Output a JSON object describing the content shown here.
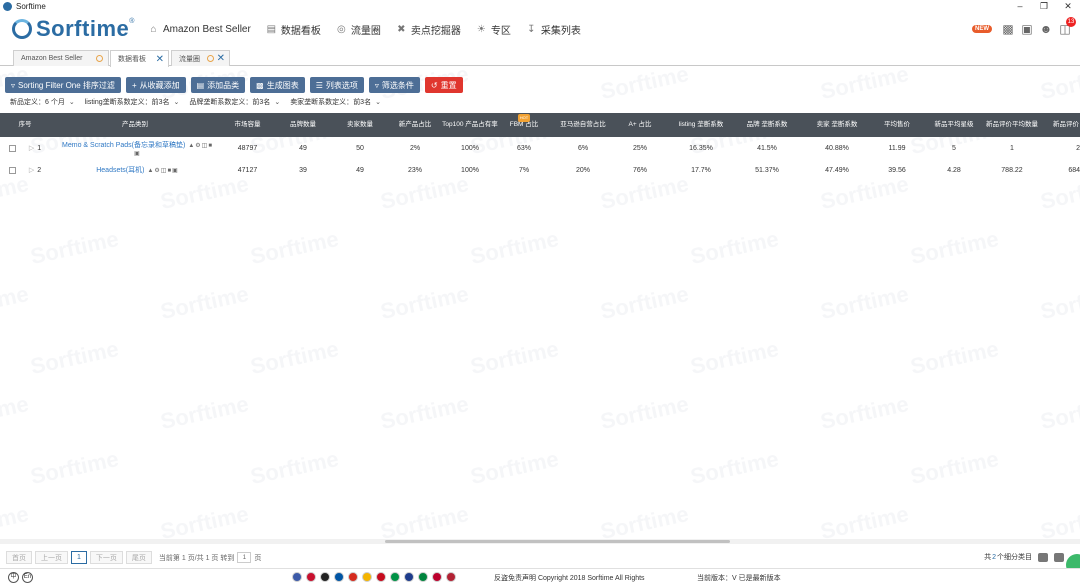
{
  "window": {
    "title": "Sorftime"
  },
  "header": {
    "brand": "Sorftime",
    "brand_mark": "®",
    "nav": [
      {
        "icon": "home-icon",
        "label": "Amazon Best Seller"
      },
      {
        "icon": "chart-board-icon",
        "label": "数据看板"
      },
      {
        "icon": "target-icon",
        "label": "流量圈"
      },
      {
        "icon": "tools-icon",
        "label": "卖点挖掘器"
      },
      {
        "icon": "bulb-icon",
        "label": "专区"
      },
      {
        "icon": "download-icon",
        "label": "采集列表"
      }
    ],
    "new_badge": "NEW",
    "cart_count": "13"
  },
  "tabs": [
    {
      "label": "Amazon Best Seller"
    },
    {
      "label": "数据看板"
    },
    {
      "label": "流量圈"
    }
  ],
  "toolbar": {
    "sort": "Sorting Filter One 排序过滤",
    "add_fav": "从收藏添加",
    "add_cat": "添加品类",
    "gen_chart": "生成图表",
    "columns": "列表选项",
    "filter": "筛选条件",
    "reset": "重置"
  },
  "filters": [
    {
      "label": "新品定义：",
      "value": "6 个月"
    },
    {
      "label": "listing垄断系数定义：",
      "value": "前3名"
    },
    {
      "label": "品牌垄断系数定义：",
      "value": "前3名"
    },
    {
      "label": "卖家垄断系数定义：",
      "value": "前3名"
    }
  ],
  "table": {
    "fbm_hot": "HOT",
    "headers": [
      "序号",
      "产品类别",
      "市场容量",
      "品牌数量",
      "卖家数量",
      "新产品占比",
      "Top100 产品占有率",
      "FBM 占比",
      "亚马逊自营占比",
      "A+ 占比",
      "listing 垄断系数",
      "品牌 垄断系数",
      "卖家 垄断系数",
      "平均售价",
      "新品平均星级",
      "新品评价平均数量",
      "新品评价"
    ],
    "rows": [
      {
        "no": "1",
        "category": "Memo & Scratch Pads(备忘录和草稿垫)",
        "cells": [
          "48797",
          "49",
          "50",
          "2%",
          "100%",
          "63%",
          "6%",
          "25%",
          "16.35%",
          "41.5%",
          "40.88%",
          "11.99",
          "5",
          "1",
          "2"
        ]
      },
      {
        "no": "2",
        "category": "Headsets(耳机)",
        "cells": [
          "47127",
          "39",
          "49",
          "23%",
          "100%",
          "7%",
          "20%",
          "76%",
          "17.7%",
          "51.37%",
          "47.49%",
          "39.56",
          "4.28",
          "788.22",
          "684"
        ]
      }
    ]
  },
  "pager": {
    "first": "首页",
    "prev": "上一页",
    "current": "1",
    "next": "下一页",
    "last": "尾页",
    "info": "当前第 1 页/共 1 页 转到",
    "goto_value": "1",
    "page_unit": "页",
    "total_prefix": "共",
    "total_count": "2",
    "total_suffix": "个细分类目"
  },
  "footer": {
    "lang_cn": "中",
    "lang_en": "En",
    "copyright": "反盗免责声明 Copyright 2018 Sorftime All Rights",
    "version": "当前版本：V  已是最新版本",
    "flag_colors": [
      "#3c5aa8",
      "#c8102e",
      "#222222",
      "#0055a4",
      "#d52b1e",
      "#f4b400",
      "#c60b1e",
      "#009246",
      "#1e3c8c",
      "#00843d",
      "#bc002d",
      "#b22234"
    ]
  },
  "colors": {
    "primary": "#2b6ca3",
    "button": "#4d6e96",
    "reset": "#e0362e",
    "header_bg": "#4a5159",
    "link": "#2f78c4"
  }
}
